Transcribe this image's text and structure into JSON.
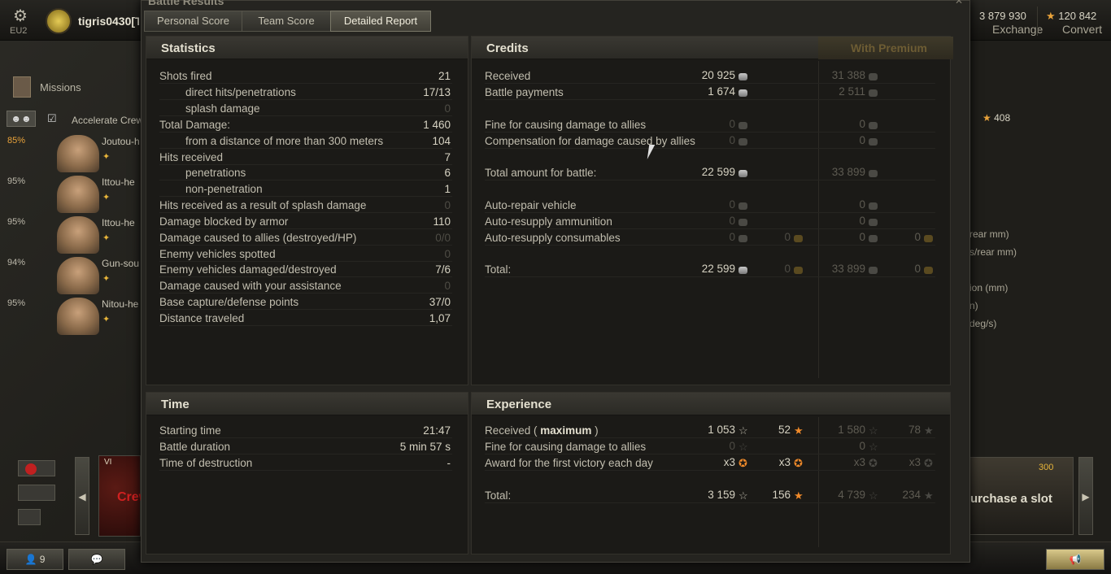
{
  "topbar": {
    "region": "EU2",
    "username": "tigris0430[T-",
    "exchange_value": "3 879 930",
    "exchange_label": "Exchange",
    "convert_value": "120 842",
    "convert_label": "Convert"
  },
  "left": {
    "missions": "Missions",
    "accelerate": "Accelerate Crew",
    "crew": [
      {
        "pct": "85%",
        "name": "Joutou-h"
      },
      {
        "pct": "95%",
        "name": "Ittou-he"
      },
      {
        "pct": "95%",
        "name": "Ittou-he"
      },
      {
        "pct": "94%",
        "name": "Gun-sou"
      },
      {
        "pct": "95%",
        "name": "Nitou-he"
      }
    ],
    "tier": "VI",
    "crew_text": "Crew"
  },
  "bottom": {
    "players": "9"
  },
  "right": {
    "stars": "408",
    "lines": [
      "rear mm)",
      "s/rear mm)",
      "ion (mm)",
      "n)",
      "deg/s)"
    ],
    "slot_price": "300",
    "slot_text": "urchase a slot"
  },
  "window": {
    "title": "Battle Results",
    "tabs": [
      "Personal Score",
      "Team Score",
      "Detailed Report"
    ]
  },
  "statistics": {
    "title": "Statistics",
    "rows": [
      {
        "label": "Shots fired",
        "value": "21"
      },
      {
        "label": "direct hits/penetrations",
        "value": "17/13"
      },
      {
        "label": "splash damage",
        "value": "0"
      },
      {
        "label": "Total Damage:",
        "value": "1 460"
      },
      {
        "label": "from a distance of more than 300 meters",
        "value": "104"
      },
      {
        "label": "Hits received",
        "value": "7"
      },
      {
        "label": "penetrations",
        "value": "6"
      },
      {
        "label": "non-penetration",
        "value": "1"
      },
      {
        "label": "Hits received as a result of splash damage",
        "value": "0"
      },
      {
        "label": "Damage blocked by armor",
        "value": "110"
      },
      {
        "label": "Damage caused to allies (destroyed/HP)",
        "value": "0/0"
      },
      {
        "label": "Enemy vehicles spotted",
        "value": "0"
      },
      {
        "label": "Enemy vehicles damaged/destroyed",
        "value": "7/6"
      },
      {
        "label": "Damage caused with your assistance",
        "value": "0"
      },
      {
        "label": "Base capture/defense points",
        "value": "37/0"
      },
      {
        "label": "Distance traveled",
        "value": "1,07"
      }
    ]
  },
  "credits": {
    "title": "Credits",
    "premium_label": "With Premium",
    "rows": [
      {
        "label": "Received",
        "c1": "20 925",
        "c2": "",
        "p1": "31 388",
        "p2": ""
      },
      {
        "label": "Battle payments",
        "c1": "1 674",
        "c2": "",
        "p1": "2 511",
        "p2": ""
      },
      {
        "label": "Fine for causing damage to allies",
        "c1": "0",
        "c2": "",
        "p1": "0",
        "p2": ""
      },
      {
        "label": "Compensation for damage caused by allies",
        "c1": "0",
        "c2": "",
        "p1": "0",
        "p2": ""
      },
      {
        "label": "Total amount for battle:",
        "c1": "22 599",
        "c2": "",
        "p1": "33 899",
        "p2": ""
      },
      {
        "label": "Auto-repair vehicle",
        "c1": "0",
        "c2": "",
        "p1": "0",
        "p2": ""
      },
      {
        "label": "Auto-resupply ammunition",
        "c1": "0",
        "c2": "",
        "p1": "0",
        "p2": ""
      },
      {
        "label": "Auto-resupply consumables",
        "c1": "0",
        "c2": "0",
        "p1": "0",
        "p2": "0"
      },
      {
        "label": "Total:",
        "c1": "22 599",
        "c2": "0",
        "p1": "33 899",
        "p2": "0"
      }
    ]
  },
  "time": {
    "title": "Time",
    "rows": [
      {
        "label": "Starting time",
        "value": "21:47"
      },
      {
        "label": "Battle duration",
        "value": "5 min 57 s"
      },
      {
        "label": "Time of destruction",
        "value": "-"
      }
    ]
  },
  "experience": {
    "title": "Experience",
    "received_label": "Received (",
    "received_bold": "maximum",
    "received_end": ")",
    "rows": [
      {
        "label": "Fine for causing damage to allies",
        "e1": "0",
        "e2": "",
        "p1": "0",
        "p2": ""
      },
      {
        "label": "Award for the first victory each day",
        "e1": "x3",
        "e2": "x3",
        "p1": "x3",
        "p2": "x3"
      },
      {
        "label": "Total:",
        "e1": "3 159",
        "e2": "156",
        "p1": "4 739",
        "p2": "234"
      }
    ],
    "received_values": {
      "e1": "1 053",
      "e2": "52",
      "p1": "1 580",
      "p2": "78"
    }
  }
}
